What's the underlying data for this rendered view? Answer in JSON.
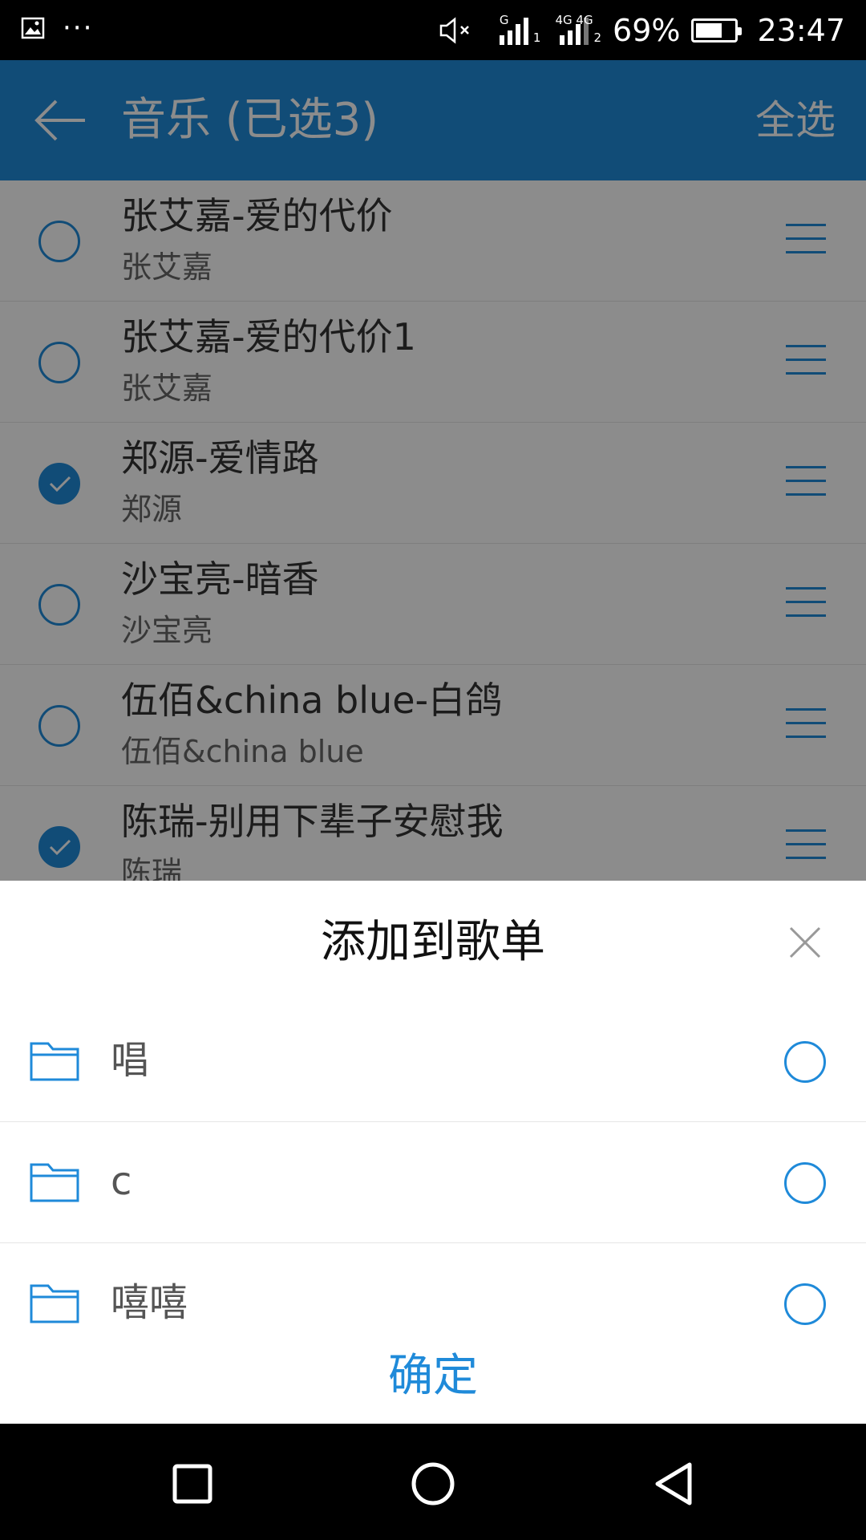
{
  "status_bar": {
    "icons": [
      "image-icon",
      "more-icon",
      "mute-icon",
      "signal-1-icon",
      "signal-2-icon",
      "battery-icon"
    ],
    "network1_tag": "G",
    "network1_sub": "1",
    "network2_tag": "4G 4G",
    "network2_sub": "2",
    "more": "···",
    "battery_percent_label": "69%",
    "battery_level": 0.69,
    "time": "23:47"
  },
  "app_bar": {
    "title": "音乐 (已选3)",
    "select_all": "全选",
    "color": "#1f8ad9"
  },
  "songs": [
    {
      "name": "张艾嘉-爱的代价",
      "artist": "张艾嘉",
      "checked": false
    },
    {
      "name": "张艾嘉-爱的代价1",
      "artist": "张艾嘉",
      "checked": false
    },
    {
      "name": "郑源-爱情路",
      "artist": "郑源",
      "checked": true
    },
    {
      "name": "沙宝亮-暗香",
      "artist": "沙宝亮",
      "checked": false
    },
    {
      "name": "伍佰&china blue-白鸽",
      "artist": "伍佰&china blue",
      "checked": false
    },
    {
      "name": "陈瑞-别用下辈子安慰我",
      "artist": "陈瑞",
      "checked": true
    }
  ],
  "sheet": {
    "title": "添加到歌单",
    "playlists": [
      {
        "name": "唱",
        "selected": false
      },
      {
        "name": "c",
        "selected": false
      },
      {
        "name": "嘻嘻",
        "selected": false
      }
    ],
    "confirm": "确定"
  },
  "nav_bar": {
    "icons": [
      "recents-icon",
      "home-icon",
      "back-icon"
    ]
  }
}
